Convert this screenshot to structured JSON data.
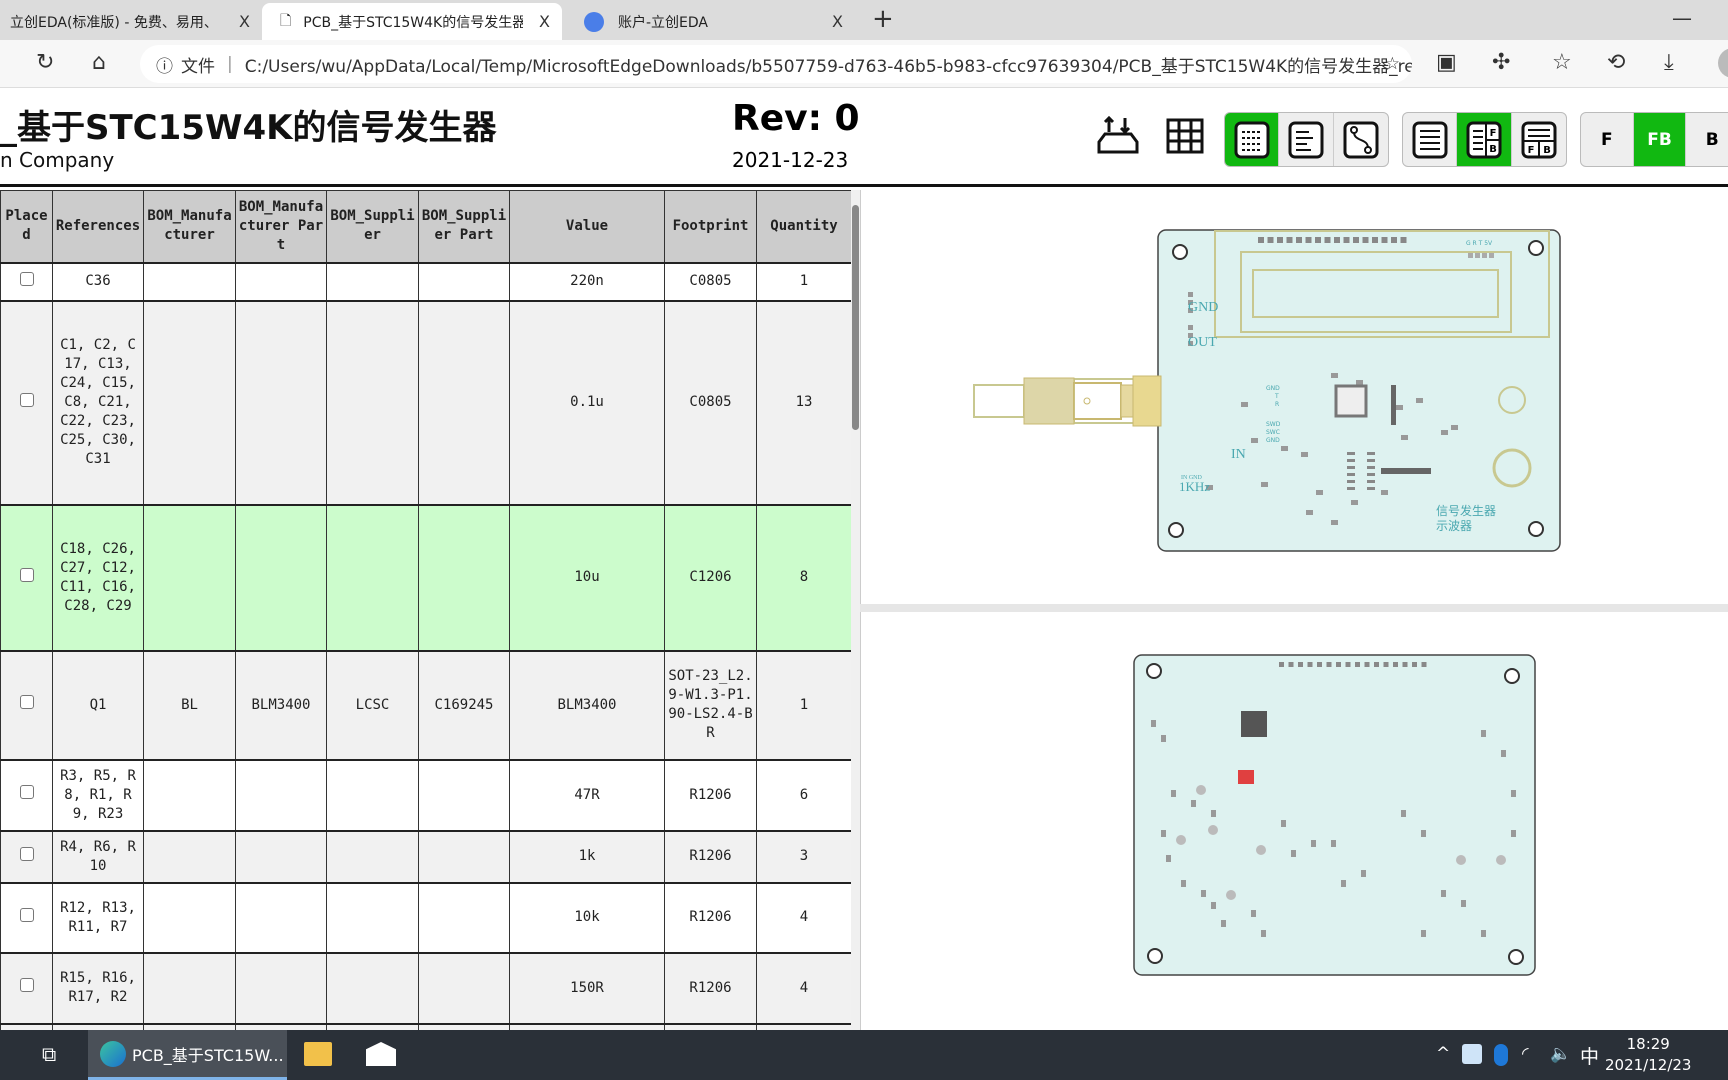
{
  "browser": {
    "tabs": [
      {
        "label": "立创EDA(标准版) - 免费、易用、",
        "active": false
      },
      {
        "label": "PCB_基于STC15W4K的信号发生器",
        "active": true
      },
      {
        "label": "账户-立创EDA",
        "active": false
      }
    ],
    "close_glyph": "X",
    "new_tab": "+",
    "minimize": "—",
    "file_label": "文件",
    "url": "C:/Users/wu/AppData/Local/Temp/MicrosoftEdgeDownloads/b5507759-d763-46b5-b983-cfcc97639304/PCB_基于STC15W4K的信号发生器_re..."
  },
  "header": {
    "title": "_基于STC15W4K的信号发生器",
    "company": "n Company",
    "rev": "Rev: 0",
    "date": "2021-12-23",
    "layer_buttons": [
      "F",
      "FB",
      "B"
    ],
    "accent": "#11b811"
  },
  "bom": {
    "columns": [
      "Placed",
      "References",
      "BOM_Manufacturer",
      "BOM_Manufacturer Part",
      "BOM_Supplier",
      "BOM_Supplier Part",
      "Value",
      "Footprint",
      "Quantity"
    ],
    "rows": [
      {
        "refs": "C36",
        "mfr": "",
        "mpart": "",
        "sup": "",
        "spart": "",
        "value": "220n",
        "fp": "C0805",
        "qty": "1"
      },
      {
        "refs": "C1, C2, C17, C13, C24, C15, C8, C21, C22, C23, C25, C30, C31",
        "mfr": "",
        "mpart": "",
        "sup": "",
        "spart": "",
        "value": "0.1u",
        "fp": "C0805",
        "qty": "13"
      },
      {
        "refs": "C18, C26, C27, C12, C11, C16, C28, C29",
        "mfr": "",
        "mpart": "",
        "sup": "",
        "spart": "",
        "value": "10u",
        "fp": "C1206",
        "qty": "8",
        "highlighted": true
      },
      {
        "refs": "Q1",
        "mfr": "BL",
        "mpart": "BLM3400",
        "sup": "LCSC",
        "spart": "C169245",
        "value": "BLM3400",
        "fp": "SOT-23_L2.9-W1.3-P1.90-LS2.4-BR",
        "qty": "1"
      },
      {
        "refs": "R3, R5, R8, R1, R9, R23",
        "mfr": "",
        "mpart": "",
        "sup": "",
        "spart": "",
        "value": "47R",
        "fp": "R1206",
        "qty": "6"
      },
      {
        "refs": "R4, R6, R10",
        "mfr": "",
        "mpart": "",
        "sup": "",
        "spart": "",
        "value": "1k",
        "fp": "R1206",
        "qty": "3"
      },
      {
        "refs": "R12, R13, R11, R7",
        "mfr": "",
        "mpart": "",
        "sup": "",
        "spart": "",
        "value": "10k",
        "fp": "R1206",
        "qty": "4"
      },
      {
        "refs": "R15, R16, R17, R2",
        "mfr": "",
        "mpart": "",
        "sup": "",
        "spart": "",
        "value": "150R",
        "fp": "R1206",
        "qty": "4"
      }
    ]
  },
  "pcb": {
    "labels": {
      "gnd": "GND",
      "out": "OUT",
      "in": "IN",
      "khz": "1KHz",
      "in_gnd": "IN GND",
      "title1": "信号发生器",
      "title2": "示波器",
      "gnd2": "GND",
      "t": "T",
      "r": "R",
      "swd": "SWD",
      "swc": "SWC",
      "gnd3": "GND",
      "header": "G R T 5V"
    },
    "board_color": "#def2f0",
    "silk_color": "#c8c890"
  },
  "taskbar": {
    "app_label": "PCB_基于STC15W...",
    "ime": "中",
    "time": "18:29",
    "date": "2021/12/23"
  }
}
